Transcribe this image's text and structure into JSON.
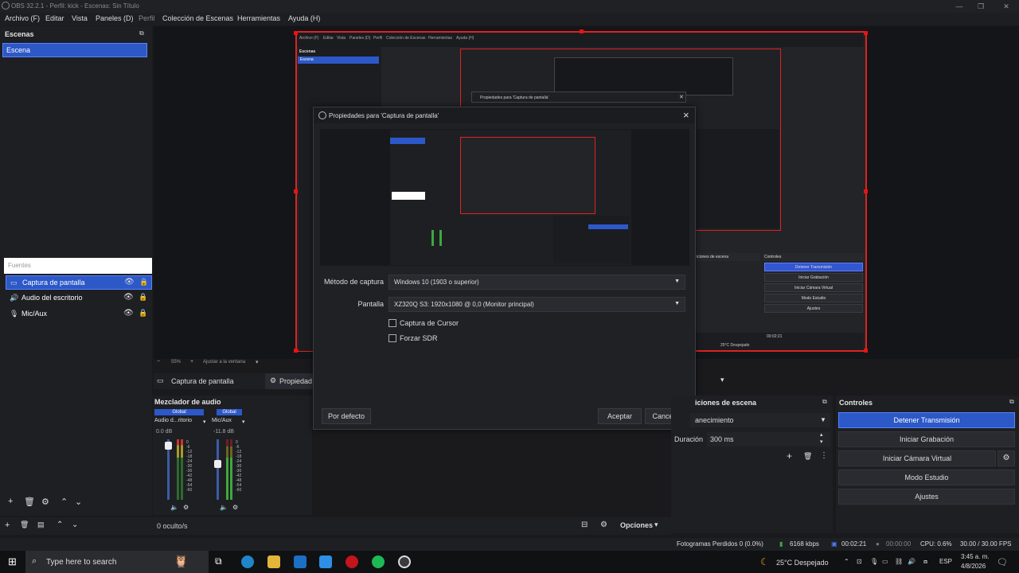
{
  "window": {
    "title": "OBS 32.2.1 - Perfil: kick - Escenas: Sin Título"
  },
  "menu": [
    {
      "label": "Archivo (F)"
    },
    {
      "label": "Editar"
    },
    {
      "label": "Vista"
    },
    {
      "label": "Paneles (D)"
    },
    {
      "label": "Perfil"
    },
    {
      "label": "Colección de Escenas"
    },
    {
      "label": "Herramientas"
    },
    {
      "label": "Ayuda (H)"
    }
  ],
  "scenes": {
    "title": "Escenas",
    "items": [
      {
        "label": "Escena"
      }
    ]
  },
  "sources": {
    "title": "Fuentes",
    "items": [
      {
        "label": "Captura de pantalla"
      },
      {
        "label": "Audio del escritorio"
      },
      {
        "label": "Mic/Aux"
      }
    ],
    "hidden_count": "0 oculto/s",
    "options_label": "Opciones"
  },
  "source_toolbar": {
    "name": "Captura de pantalla",
    "props": "Propiedad"
  },
  "dialog": {
    "title": "Propiedades para 'Captura de pantalla'",
    "method_label": "Método de captura",
    "method_value": "Windows 10 (1903 o superior)",
    "screen_label": "Pantalla",
    "screen_value": "XZ320Q S3: 1920x1080 @ 0,0 (Monitor principal)",
    "cursor_label": "Captura de Cursor",
    "sdr_label": "Forzar SDR",
    "default_btn": "Por defecto",
    "ok_btn": "Aceptar",
    "cancel_btn": "Cancelar"
  },
  "preview_bar": {
    "zoom": "55%",
    "fit": "Ajustar a la ventana"
  },
  "mixer": {
    "title": "Mezclador de audio",
    "channels": [
      {
        "global": "Global",
        "name": "Audio d...ritorio",
        "db": "0.0 dB",
        "level": 0.9
      },
      {
        "global": "Global",
        "name": "Mic/Aux",
        "db": "-11.8 dB",
        "level": 0.55
      }
    ],
    "scale": [
      "0",
      "-6",
      "-12",
      "-18",
      "-24",
      "-30",
      "-36",
      "-42",
      "-48",
      "-54",
      "-60"
    ]
  },
  "transitions": {
    "title": "iciones de escena",
    "selected": "anecimiento",
    "duration_label": "Duración",
    "duration_value": "300 ms"
  },
  "controls": {
    "title": "Controles",
    "buttons": [
      {
        "label": "Detener Transmisión"
      },
      {
        "label": "Iniciar Grabación"
      },
      {
        "label": "Iniciar Cámara Virtual"
      },
      {
        "label": "Modo Estudio"
      },
      {
        "label": "Ajustes"
      }
    ]
  },
  "status": {
    "dropped": "Fotogramas Perdidos 0 (0.0%)",
    "bitrate": "6168 kbps",
    "stream_time": "00:02:21",
    "rec_time": "00:00:00",
    "cpu": "CPU: 0.6%",
    "fps": "30.00 / 30.00 FPS"
  },
  "taskbar": {
    "search_placeholder": "Type here to search",
    "weather": "25°C  Despejado",
    "lang": "ESP",
    "time": "3:45 a. m.",
    "date": "4/8/2026"
  },
  "mini_preview": {
    "menu": [
      "Archivo (F)",
      "Editar",
      "Vista",
      "Paneles (D)",
      "Perfil",
      "Colección de Escenas",
      "Herramientas",
      "Ayuda (H)"
    ],
    "scenes_title": "Escenas",
    "scene_item": "Escena",
    "dialog_title": "Propiedades para 'Captura de pantalla'",
    "controls_title": "Controles",
    "transitions_title": "iciones de escena",
    "buttons": [
      "Detener Transmisión",
      "Iniciar Grabación",
      "Iniciar Cámara Virtual",
      "Modo Estudio",
      "Ajustes"
    ],
    "status_time": "00:02:21",
    "status_weather": "25°C Despejado"
  }
}
